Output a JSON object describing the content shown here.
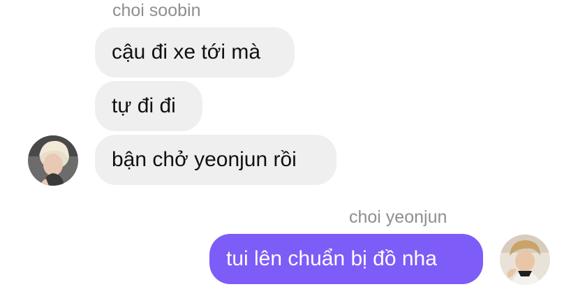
{
  "conversation": {
    "incoming": {
      "sender_name": "choi soobin",
      "avatar_icon": "person-avatar-icon",
      "messages": [
        "cậu đi xe tới mà",
        "tự đi đi",
        "bận chở yeonjun rồi"
      ]
    },
    "outgoing": {
      "sender_name": "choi yeonjun",
      "avatar_icon": "person-avatar-icon",
      "messages": [
        "tui lên chuẩn bị đồ nha"
      ]
    }
  },
  "colors": {
    "incoming_bubble": "#efefef",
    "outgoing_bubble": "#7e5cf7",
    "name_text": "#8e8e93"
  }
}
